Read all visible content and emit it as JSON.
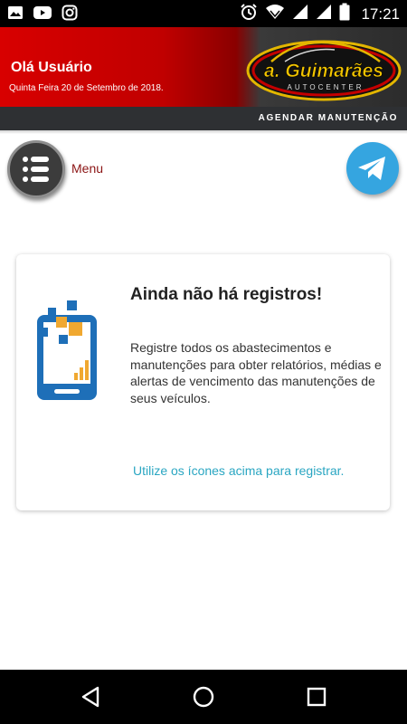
{
  "status_bar": {
    "time": "17:21",
    "left_icons": [
      "gallery-icon",
      "youtube-icon",
      "instagram-icon"
    ],
    "right_icons": [
      "alarm-icon",
      "wifi-icon",
      "signal-icon",
      "signal-icon",
      "battery-icon"
    ]
  },
  "header": {
    "greeting": "Olá Usuário",
    "date": "Quinta Feira 20 de Setembro de 2018.",
    "logo_text": "a. Guimarães",
    "logo_subtext": "AUTOCENTER",
    "action_label": "AGENDAR MANUTENÇÃO"
  },
  "menu": {
    "label": "Menu",
    "icon": "list-icon"
  },
  "telegram": {
    "icon": "telegram-icon"
  },
  "empty_state": {
    "title": "Ainda não há registros!",
    "description": "Registre todos os abastecimentos e manutenções para obter relatórios, médias e alertas de vencimento das manutenções de seus veículos.",
    "hint": "Utilize os ícones acima para registrar.",
    "illustration_icon": "phone-chart-icon"
  },
  "nav_bar": {
    "buttons": [
      "back-icon",
      "home-icon",
      "recents-icon"
    ]
  },
  "colors": {
    "header_red": "#d80000",
    "menu_label": "#8b1414",
    "telegram_blue": "#35a5e0",
    "link": "#2aa6c2",
    "illustration_blue": "#1e6fb8",
    "illustration_orange": "#f0a830"
  }
}
